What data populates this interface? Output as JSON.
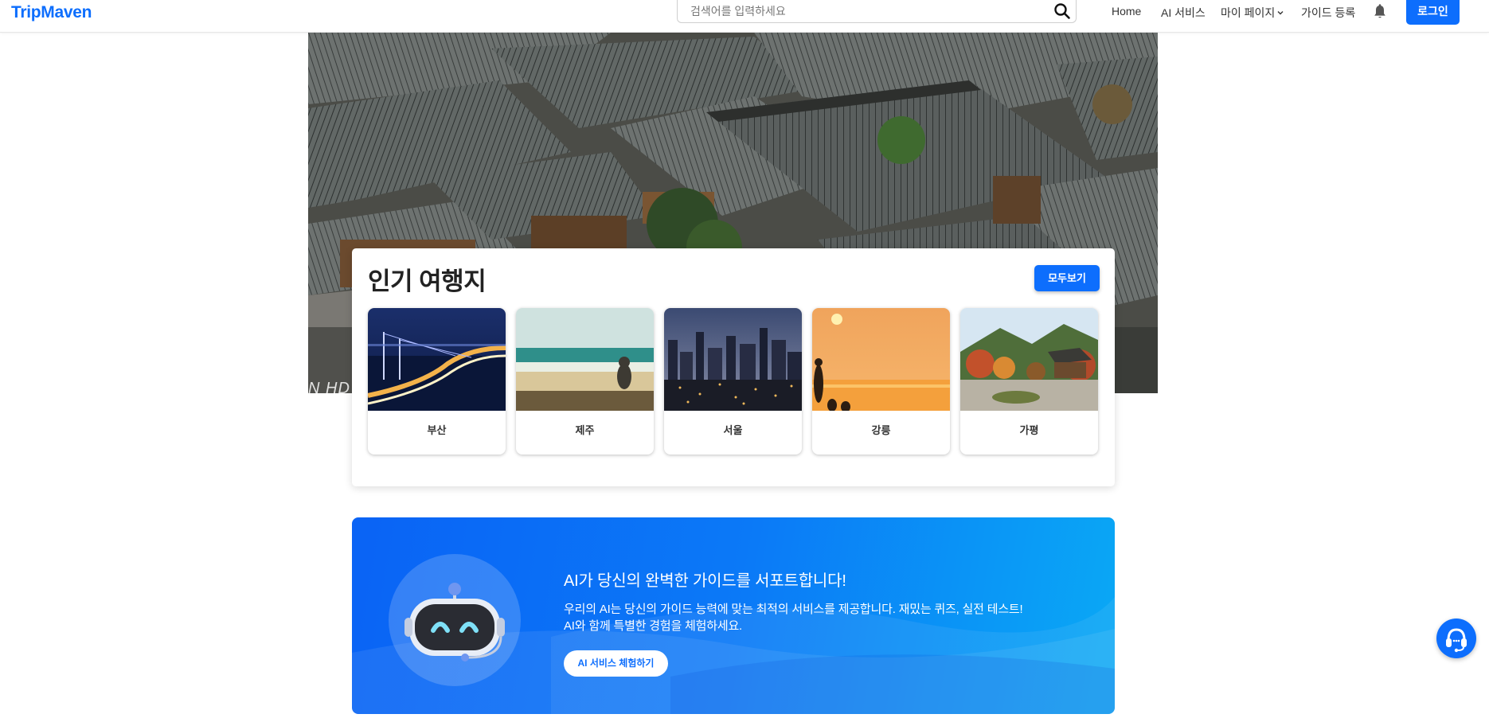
{
  "navbar": {
    "brand": "TripMaven",
    "search_placeholder": "검색어를 입력하세요",
    "links": {
      "home": "Home",
      "ai_service": "AI 서비스",
      "my_page": "마이 페이지",
      "guide_register": "가이드 등록"
    },
    "login": "로그인"
  },
  "hero": {
    "caption": "N HD"
  },
  "popular": {
    "title": "인기 여행지",
    "view_all": "모두보기",
    "destinations": [
      {
        "name": "부산"
      },
      {
        "name": "제주"
      },
      {
        "name": "서울"
      },
      {
        "name": "강릉"
      },
      {
        "name": "가평"
      }
    ]
  },
  "ai_banner": {
    "title": "AI가 당신의 완벽한 가이드를 서포트합니다!",
    "desc_line1": "우리의 AI는 당신의 가이드 능력에 맞는 최적의 서비스를 제공합니다. 재밌는 퀴즈, 실전 테스트!",
    "desc_line2": "AI와 함께 특별한 경험을 체험하세요.",
    "button": "AI 서비스 체험하기"
  },
  "colors": {
    "brand": "#0d6efd",
    "banner_start": "#0a63f5",
    "banner_end": "#0aa9f5"
  },
  "icons": {
    "search": "search-icon",
    "bell": "bell-icon",
    "chevron": "chevron-down-icon",
    "chat": "headset-icon"
  }
}
